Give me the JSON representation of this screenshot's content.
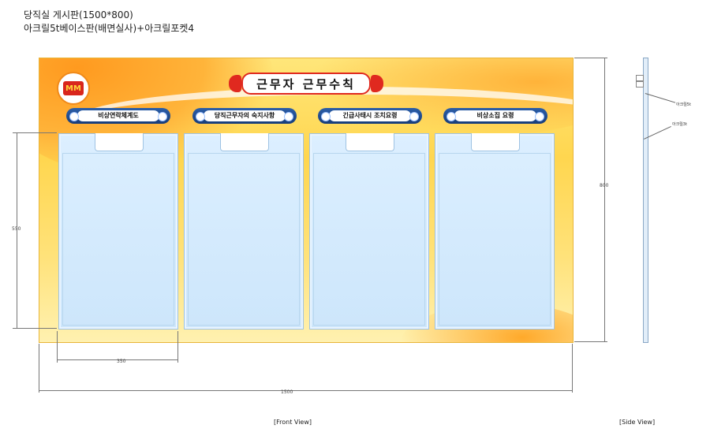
{
  "header": {
    "line1": "당직실 게시판(1500*800)",
    "line2": "아크릴5t베이스판(배면실사)+아크릴포켓4"
  },
  "board": {
    "main_title": "근무자 근무수칙",
    "logo_text": "MM",
    "sections": [
      {
        "label": "비상연락체계도"
      },
      {
        "label": "당직근무자의 숙지사항"
      },
      {
        "label": "긴급사태시 조치요령"
      },
      {
        "label": "비상소집 요령"
      }
    ],
    "colors": {
      "background": "#ffd64f",
      "accent_orange": "#ff9a1f",
      "banner_red": "#e0291f",
      "pill_blue": "#1f4a8f",
      "pocket": "#d6ecff"
    }
  },
  "dimensions": {
    "total_width": "1500",
    "total_height": "800",
    "pocket_height": "550",
    "pocket_width": "350"
  },
  "side_view": {
    "label_a": "아크릴5t",
    "label_b": "아크릴3t"
  },
  "captions": {
    "front": "[Front View]",
    "side": "[Side View]"
  }
}
